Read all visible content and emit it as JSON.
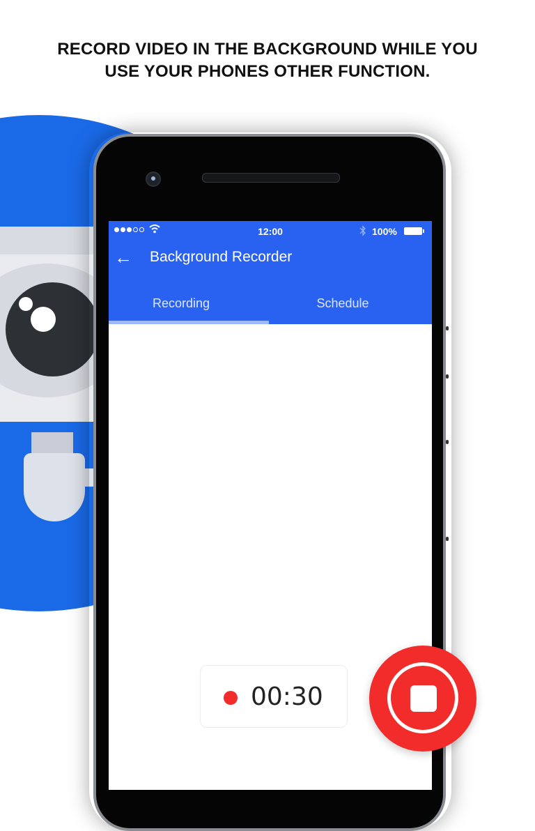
{
  "headline": {
    "line1": "RECORD VIDEO IN THE BACKGROUND WHILE YOU",
    "line2": "USE YOUR PHONES OTHER FUNCTION."
  },
  "status_bar": {
    "signal_bars_on": 3,
    "signal_bars_total": 5,
    "wifi_icon": "wifi-icon",
    "time": "12:00",
    "bluetooth_icon": "bluetooth-icon",
    "battery_percent": "100%",
    "battery_icon": "battery-icon"
  },
  "app_bar": {
    "back_icon": "arrow-left-icon",
    "back_glyph": "←",
    "title": "Background Recorder"
  },
  "tabs": [
    {
      "label": "Recording",
      "active": true
    },
    {
      "label": "Schedule",
      "active": false
    }
  ],
  "recorder": {
    "elapsed": "00:30",
    "status_icon": "recording-dot-icon",
    "stop_button_icon": "stop-icon"
  },
  "colors": {
    "brand_blue": "#2962f0",
    "background_blue": "#1a6ae8",
    "record_red": "#f22b2b",
    "tab_indicator": "#9db8f7"
  }
}
